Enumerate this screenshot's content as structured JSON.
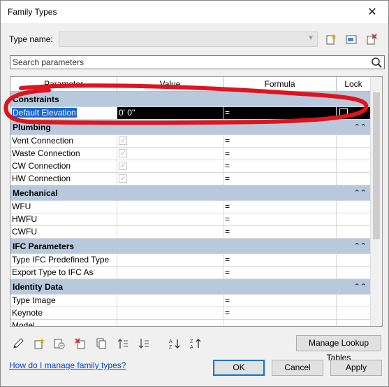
{
  "window": {
    "title": "Family Types",
    "close_glyph": "✕"
  },
  "type_name": {
    "label": "Type name:",
    "value": ""
  },
  "search": {
    "placeholder": "Search parameters"
  },
  "columns": [
    "Parameter",
    "Value",
    "Formula",
    "Lock"
  ],
  "groups": [
    {
      "name": "Constraints",
      "rows": [
        {
          "param": "Default Elevation",
          "value": "0'  0\"",
          "formula": "=",
          "lock": false,
          "selected": true
        }
      ]
    },
    {
      "name": "Plumbing",
      "rows": [
        {
          "param": "Vent Connection",
          "checkbox": true,
          "formula": "="
        },
        {
          "param": "Waste Connection",
          "checkbox": true,
          "formula": "="
        },
        {
          "param": "CW Connection",
          "checkbox": true,
          "formula": "="
        },
        {
          "param": "HW Connection",
          "checkbox": true,
          "formula": "="
        }
      ]
    },
    {
      "name": "Mechanical",
      "rows": [
        {
          "param": "WFU",
          "formula": "="
        },
        {
          "param": "HWFU",
          "formula": "="
        },
        {
          "param": "CWFU",
          "formula": "="
        }
      ]
    },
    {
      "name": "IFC Parameters",
      "rows": [
        {
          "param": "Type IFC Predefined Type",
          "formula": "="
        },
        {
          "param": "Export Type to IFC As",
          "formula": "="
        }
      ]
    },
    {
      "name": "Identity Data",
      "rows": [
        {
          "param": "Type Image",
          "formula": "="
        },
        {
          "param": "Keynote",
          "formula": "="
        },
        {
          "param": "Model",
          "formula": ""
        }
      ]
    }
  ],
  "buttons": {
    "manage_lookup": "Manage Lookup Tables",
    "ok": "OK",
    "cancel": "Cancel",
    "apply": "Apply"
  },
  "help_link": "How do I manage family types?"
}
